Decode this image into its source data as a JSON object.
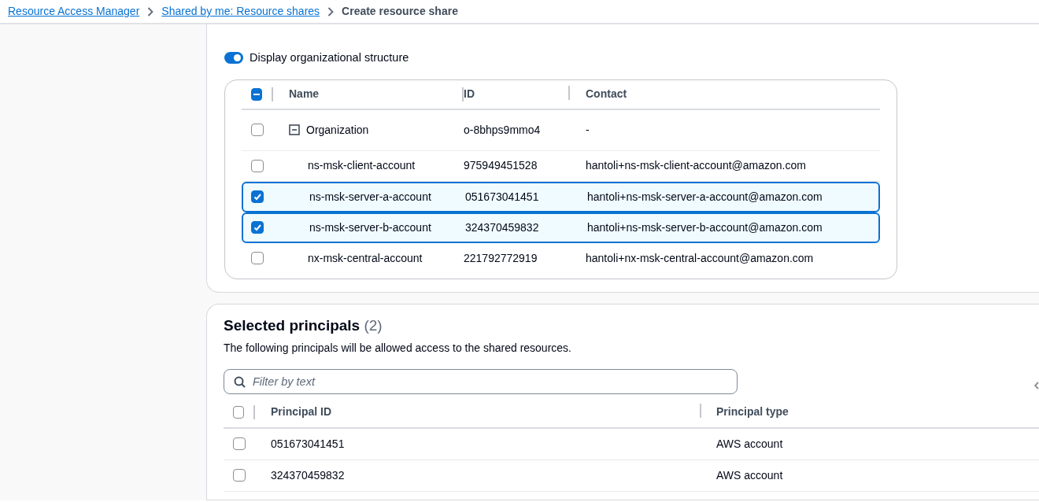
{
  "breadcrumbs": [
    {
      "label": "Resource Access Manager",
      "kind": "link"
    },
    {
      "label": "Shared by me: Resource shares",
      "kind": "link"
    },
    {
      "label": "Create resource share",
      "kind": "current"
    }
  ],
  "toggle": {
    "label": "Display organizational structure",
    "on": true
  },
  "org_table": {
    "header_checkbox": {
      "indeterminate": true
    },
    "columns": [
      "Name",
      "ID",
      "Contact"
    ],
    "rows": [
      {
        "name": "Organization",
        "id": "o-8bhps9mmo4",
        "contact": "-",
        "checked": false,
        "expanded": true,
        "children": [
          {
            "name": "ns-msk-client-account",
            "id": "975949451528",
            "contact": "hantoli+ns-msk-client-account@amazon.com",
            "checked": false
          },
          {
            "name": "ns-msk-server-a-account",
            "id": "051673041451",
            "contact": "hantoli+ns-msk-server-a-account@amazon.com",
            "checked": true
          },
          {
            "name": "ns-msk-server-b-account",
            "id": "324370459832",
            "contact": "hantoli+ns-msk-server-b-account@amazon.com",
            "checked": true
          },
          {
            "name": "nx-msk-central-account",
            "id": "221792772919",
            "contact": "hantoli+nx-msk-central-account@amazon.com",
            "checked": false
          }
        ]
      }
    ]
  },
  "selected_principals": {
    "title": "Selected principals",
    "count": "(2)",
    "description": "The following principals will be allowed access to the shared resources.",
    "filter": {
      "placeholder": "Filter by text"
    },
    "header_checkbox": {
      "indeterminate": false
    },
    "columns": [
      "Principal ID",
      "Principal type"
    ],
    "rows": [
      {
        "principal_id": "051673041451",
        "principal_type": "AWS account",
        "checked": false
      },
      {
        "principal_id": "324370459832",
        "principal_type": "AWS account",
        "checked": false
      }
    ]
  }
}
